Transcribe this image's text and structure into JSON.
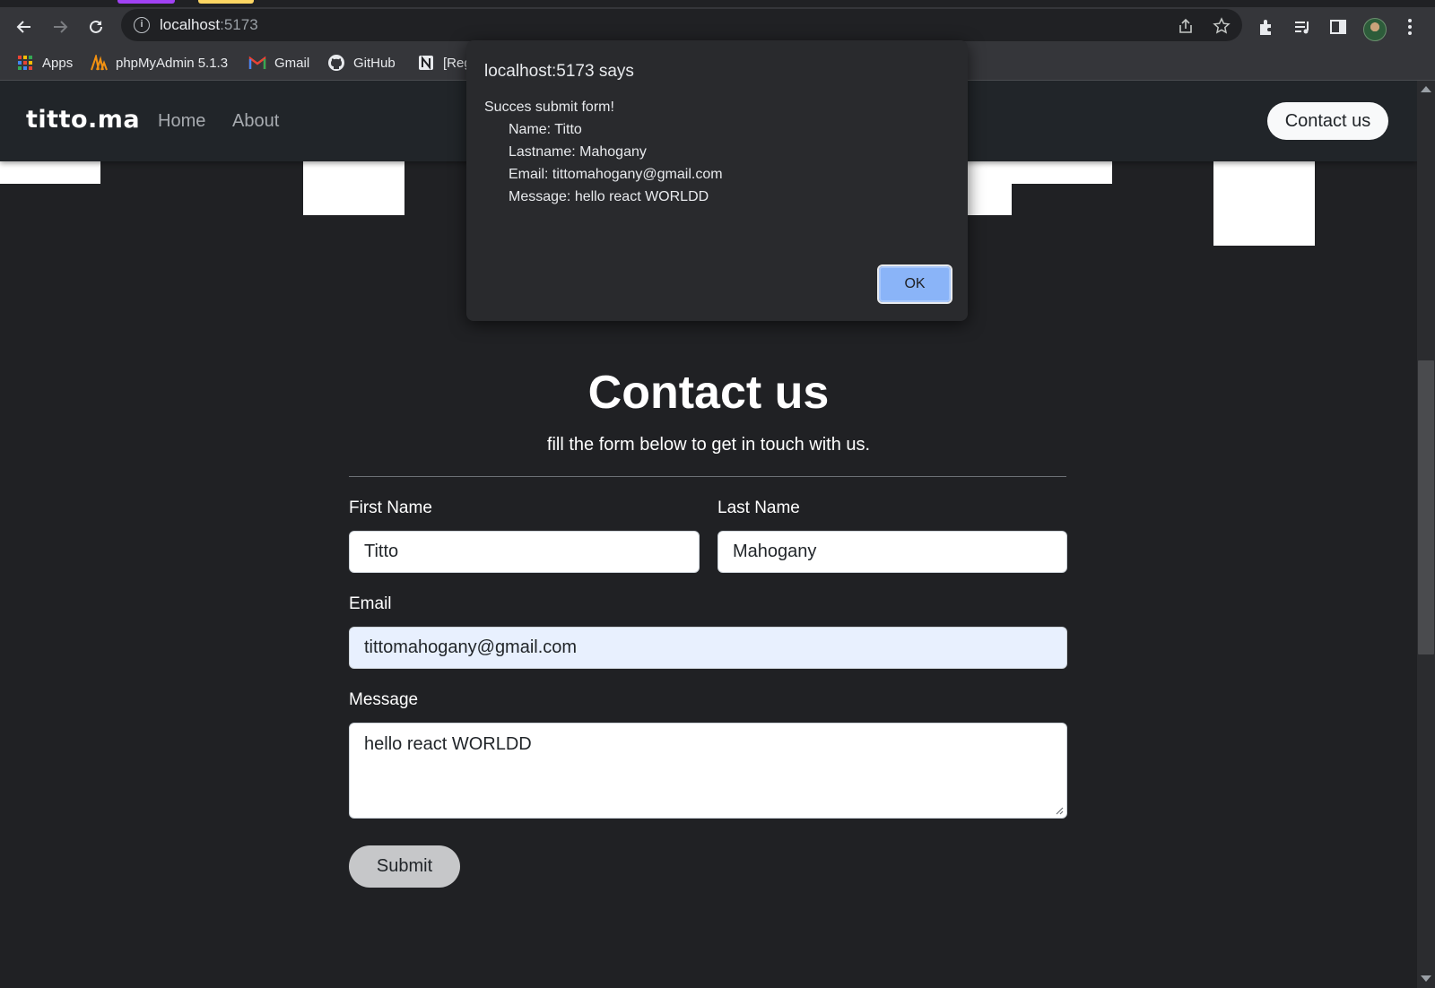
{
  "browser": {
    "url_host": "localhost",
    "url_port": ":5173",
    "bookmarks": [
      {
        "label": "Apps",
        "icon": "apps-grid-icon"
      },
      {
        "label": "phpMyAdmin 5.1.3",
        "icon": "phpmyadmin-icon"
      },
      {
        "label": "Gmail",
        "icon": "gmail-icon"
      },
      {
        "label": "GitHub",
        "icon": "github-icon"
      },
      {
        "label": "[Reg",
        "icon": "notion-icon"
      }
    ],
    "tab_accent_colors": [
      "#a142f4",
      "#fdd663"
    ]
  },
  "navbar": {
    "brand": "titto.ma",
    "links": [
      "Home",
      "About"
    ],
    "cta": "Contact us"
  },
  "page": {
    "heading": "Contact us",
    "subheading": "fill the form below to get in touch with us."
  },
  "form": {
    "first_name": {
      "label": "First Name",
      "value": "Titto"
    },
    "last_name": {
      "label": "Last Name",
      "value": "Mahogany"
    },
    "email": {
      "label": "Email",
      "value": "tittomahogany@gmail.com"
    },
    "message": {
      "label": "Message",
      "value": "hello react WORLDD"
    },
    "submit": "Submit"
  },
  "dialog": {
    "title": "localhost:5173 says",
    "headline": "Succes submit form!",
    "lines": [
      "Name: Titto",
      "Lastname: Mahogany",
      "Email: tittomahogany@gmail.com",
      "Message: hello react WORLDD"
    ],
    "ok": "OK"
  }
}
